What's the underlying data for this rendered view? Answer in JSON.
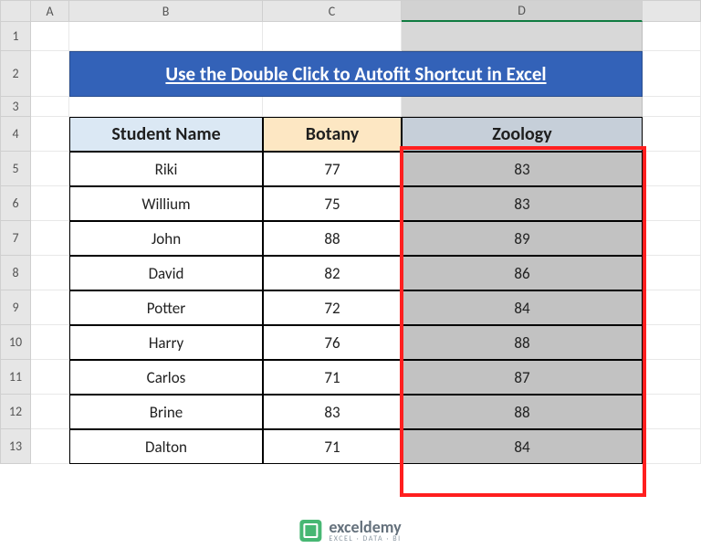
{
  "columns": [
    "A",
    "B",
    "C",
    "D"
  ],
  "selected_column_index": 3,
  "rows": [
    "1",
    "2",
    "3",
    "4",
    "5",
    "6",
    "7",
    "8",
    "9",
    "10",
    "11",
    "12",
    "13"
  ],
  "title": "Use the Double Click to Autofit Shortcut in Excel",
  "headers": {
    "b": "Student Name",
    "c": "Botany",
    "d": "Zoology"
  },
  "data": [
    {
      "name": "Riki",
      "botany": "77",
      "zoology": "83"
    },
    {
      "name": "Willium",
      "botany": "75",
      "zoology": "83"
    },
    {
      "name": "John",
      "botany": "88",
      "zoology": "89"
    },
    {
      "name": "David",
      "botany": "82",
      "zoology": "86"
    },
    {
      "name": "Potter",
      "botany": "72",
      "zoology": "84"
    },
    {
      "name": "Harry",
      "botany": "76",
      "zoology": "88"
    },
    {
      "name": "Carlos",
      "botany": "71",
      "zoology": "87"
    },
    {
      "name": "Brine",
      "botany": "83",
      "zoology": "88"
    },
    {
      "name": "Dalton",
      "botany": "71",
      "zoology": "84"
    }
  ],
  "watermark": {
    "main": "exceldemy",
    "sub": "EXCEL · DATA · BI"
  },
  "chart_data": {
    "type": "table",
    "title": "Use the Double Click to Autofit Shortcut in Excel",
    "columns": [
      "Student Name",
      "Botany",
      "Zoology"
    ],
    "rows": [
      [
        "Riki",
        77,
        83
      ],
      [
        "Willium",
        75,
        83
      ],
      [
        "John",
        88,
        89
      ],
      [
        "David",
        82,
        86
      ],
      [
        "Potter",
        72,
        84
      ],
      [
        "Harry",
        76,
        88
      ],
      [
        "Carlos",
        71,
        87
      ],
      [
        "Brine",
        83,
        88
      ],
      [
        "Dalton",
        71,
        84
      ]
    ]
  }
}
